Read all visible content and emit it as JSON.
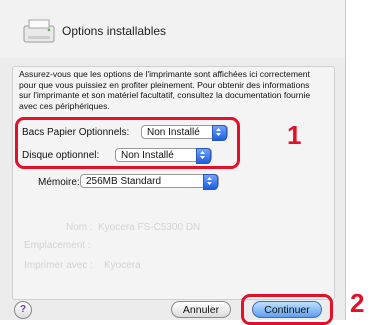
{
  "dialog": {
    "title": "Options installables",
    "description": "Assurez-vous que les options de l'imprimante sont affichées ici correctement pour que vous puissiez en profiter pleinement. Pour obtenir des informations sur l'imprimante et son matériel facultatif, consultez la documentation fournie avec ces périphériques."
  },
  "options": {
    "tray_label": "Bacs Papier Optionnels:",
    "tray_value": "Non Installé",
    "disk_label": "Disque optionnel:",
    "disk_value": "Non Installé",
    "memory_label": "Mémoire:",
    "memory_value": "256MB Standard"
  },
  "background": {
    "name_label": "Nom :",
    "printer_name": "Kyocera FS-C5300 DN",
    "location": "Emplacement :",
    "print_with": "Imprimer avec :",
    "driver": "Kyocera"
  },
  "buttons": {
    "help": "?",
    "cancel": "Annuler",
    "continue": "Continuer"
  },
  "callouts": {
    "one": "1",
    "two": "2"
  },
  "colors": {
    "highlight": "#e3102a",
    "stepper": "#1e5fe0"
  }
}
